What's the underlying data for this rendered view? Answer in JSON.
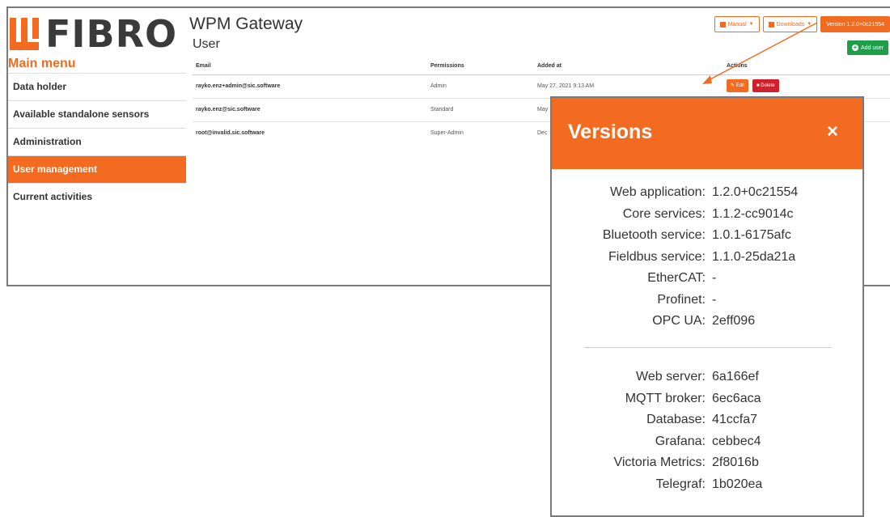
{
  "logo": {
    "text": "FIBRO"
  },
  "header": {
    "app_title": "WPM Gateway",
    "page_title": "User"
  },
  "top_buttons": {
    "manual": "Manual",
    "downloads": "Downloads",
    "version": "Version 1.2.0+0c21554"
  },
  "add_user": "Add user",
  "sidebar": {
    "heading": "Main menu",
    "items": [
      {
        "label": "Data holder"
      },
      {
        "label": "Available standalone sensors"
      },
      {
        "label": "Administration"
      },
      {
        "label": "User management"
      },
      {
        "label": "Current activities"
      }
    ]
  },
  "table": {
    "columns": [
      "Email",
      "Permissions",
      "Added at",
      "Actions"
    ],
    "rows": [
      {
        "email": "rayko.enz+admin@sic.software",
        "permission": "Admin",
        "added": "May 27, 2021 9:13 AM"
      },
      {
        "email": "rayko.enz@sic.software",
        "permission": "Standard",
        "added": "May"
      },
      {
        "email": "root@invalid.sic.software",
        "permission": "Super-Admin",
        "added": "Dec"
      }
    ],
    "edit_label": "Edit",
    "delete_label": "Delete"
  },
  "versions_dialog": {
    "title": "Versions",
    "close": "×",
    "group1": [
      {
        "label": "Web application:",
        "value": "1.2.0+0c21554"
      },
      {
        "label": "Core services:",
        "value": "1.1.2-cc9014c"
      },
      {
        "label": "Bluetooth service:",
        "value": "1.0.1-6175afc"
      },
      {
        "label": "Fieldbus service:",
        "value": "1.1.0-25da21a"
      },
      {
        "label": "EtherCAT:",
        "value": "-"
      },
      {
        "label": "Profinet:",
        "value": "-"
      },
      {
        "label": "OPC UA:",
        "value": "2eff096"
      }
    ],
    "group2": [
      {
        "label": "Web server:",
        "value": "6a166ef"
      },
      {
        "label": "MQTT broker:",
        "value": "6ec6aca"
      },
      {
        "label": "Database:",
        "value": "41ccfa7"
      },
      {
        "label": "Grafana:",
        "value": "cebbec4"
      },
      {
        "label": "Victoria Metrics:",
        "value": "2f8016b"
      },
      {
        "label": "Telegraf:",
        "value": "1b020ea"
      }
    ]
  },
  "colors": {
    "accent": "#f26b21",
    "success": "#1f9e4a",
    "danger": "#d0202b"
  }
}
